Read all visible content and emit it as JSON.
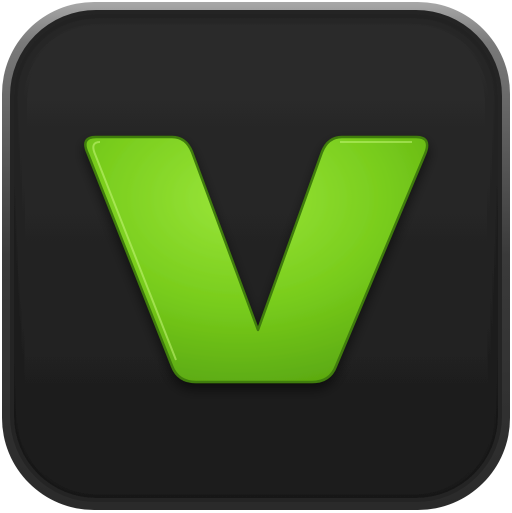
{
  "icon": {
    "glyph": "V",
    "glyph_icon": "letter-v-logo-icon",
    "colors": {
      "background": "#ffffff",
      "bezel_light": "#9a9a9a",
      "bezel_dark": "#2e2e2e",
      "face_top": "#2c2c2c",
      "face_bottom": "#1a1a1a",
      "glyph_green": "#7ed21f",
      "glyph_green_light": "#9ae63a",
      "glyph_green_dark": "#4f9a0c",
      "glyph_outline": "#3f7d0a"
    }
  }
}
